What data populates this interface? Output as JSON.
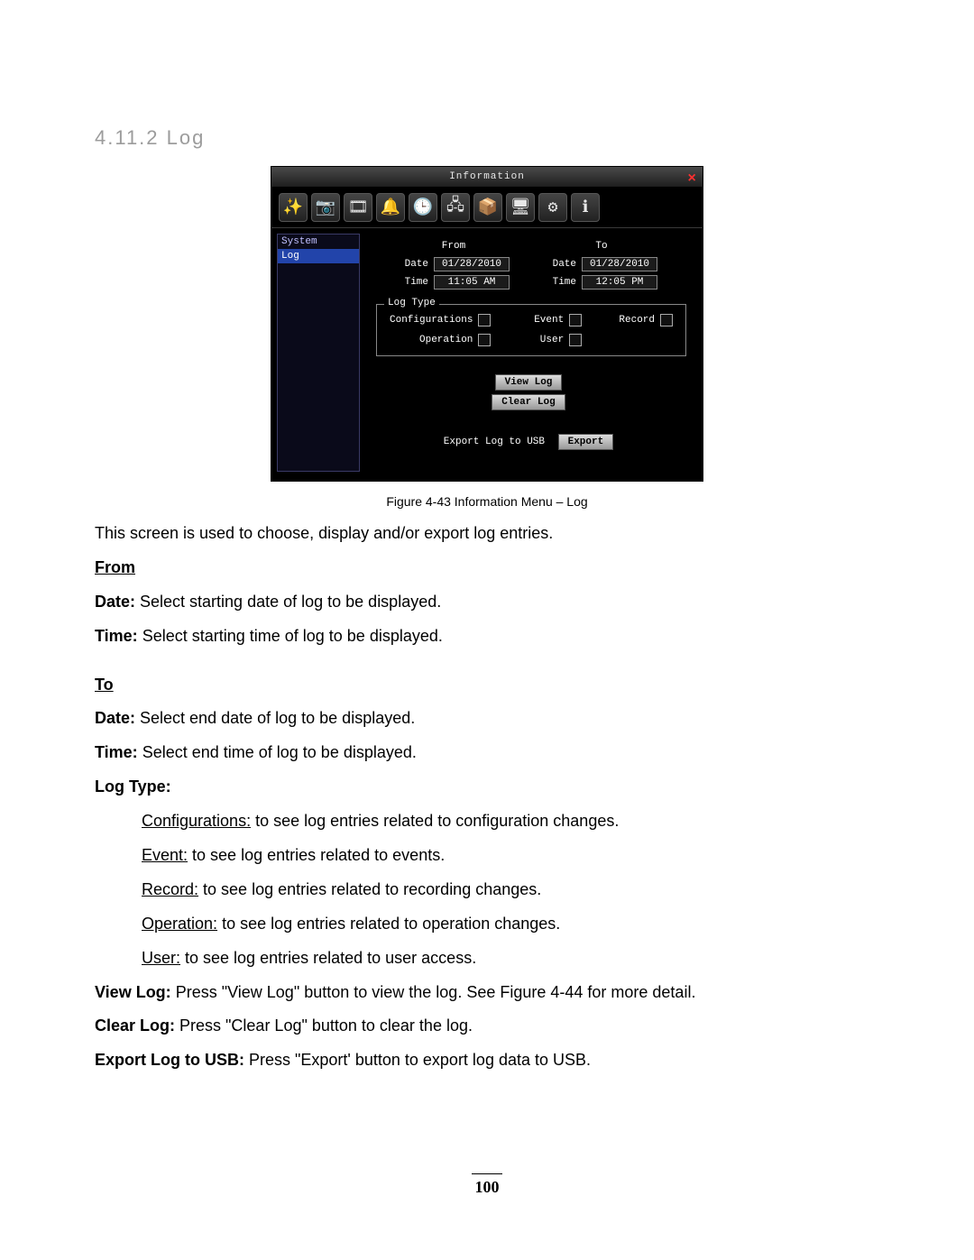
{
  "heading": "4.11.2 Log",
  "window": {
    "title": "Information",
    "close_glyph": "×",
    "sidebar": {
      "items": [
        "System",
        "Log"
      ],
      "active_index": 1
    },
    "toolbar_icons": [
      {
        "name": "wizard-icon",
        "glyph": "✨"
      },
      {
        "name": "camera-icon",
        "glyph": "📷"
      },
      {
        "name": "record-icon",
        "glyph": "🎞"
      },
      {
        "name": "alarm-icon",
        "glyph": "🔔"
      },
      {
        "name": "schedule-icon",
        "glyph": "🕒"
      },
      {
        "name": "network-icon",
        "glyph": "🖧"
      },
      {
        "name": "storage-icon",
        "glyph": "📦"
      },
      {
        "name": "display-icon",
        "glyph": "🖥"
      },
      {
        "name": "settings-icon",
        "glyph": "⚙"
      },
      {
        "name": "info-icon",
        "glyph": "ℹ"
      }
    ],
    "from": {
      "label": "From",
      "date_label": "Date",
      "date_value": "01/28/2010",
      "time_label": "Time",
      "time_value": "11:05 AM"
    },
    "to": {
      "label": "To",
      "date_label": "Date",
      "date_value": "01/28/2010",
      "time_label": "Time",
      "time_value": "12:05 PM"
    },
    "logtype": {
      "legend": "Log Type",
      "items": [
        "Configurations",
        "Event",
        "Record",
        "Operation",
        "User"
      ]
    },
    "buttons": {
      "view_log": "View Log",
      "clear_log": "Clear Log",
      "export_label": "Export Log to USB",
      "export": "Export"
    }
  },
  "figure_caption": "Figure 4-43 Information Menu – Log",
  "text": {
    "intro": "This screen is used to choose, display and/or export log entries.",
    "from_head": "From",
    "from_date_label": "Date:",
    "from_date_text": " Select starting date of log to be displayed.",
    "from_time_label": "Time:",
    "from_time_text": " Select starting time of log to be displayed.",
    "to_head": "To",
    "to_date_label": "Date:",
    "to_date_text": " Select end date of log to be displayed.",
    "to_time_label": "Time:",
    "to_time_text": " Select end time of log to be displayed.",
    "logtype_head": "Log Type:",
    "lt_conf_label": "Configurations:",
    "lt_conf_text": " to see log entries related to configuration changes.",
    "lt_event_label": "Event:",
    "lt_event_text": " to see log entries related to events.",
    "lt_record_label": "Record:",
    "lt_record_text": " to see log entries related to recording changes.",
    "lt_op_label": "Operation:",
    "lt_op_text": " to see log entries related to operation changes.",
    "lt_user_label": "User:",
    "lt_user_text": " to see log entries related to user access.",
    "viewlog_label": "View Log:",
    "viewlog_text": " Press \"View Log\" button to view the log. See Figure 4-44 for more detail.",
    "clearlog_label": "Clear Log:",
    "clearlog_text": " Press \"Clear Log\" button to clear the log.",
    "export_label": "Export Log to USB:",
    "export_text": " Press \"Export' button to export log data to USB."
  },
  "page_number": "100"
}
